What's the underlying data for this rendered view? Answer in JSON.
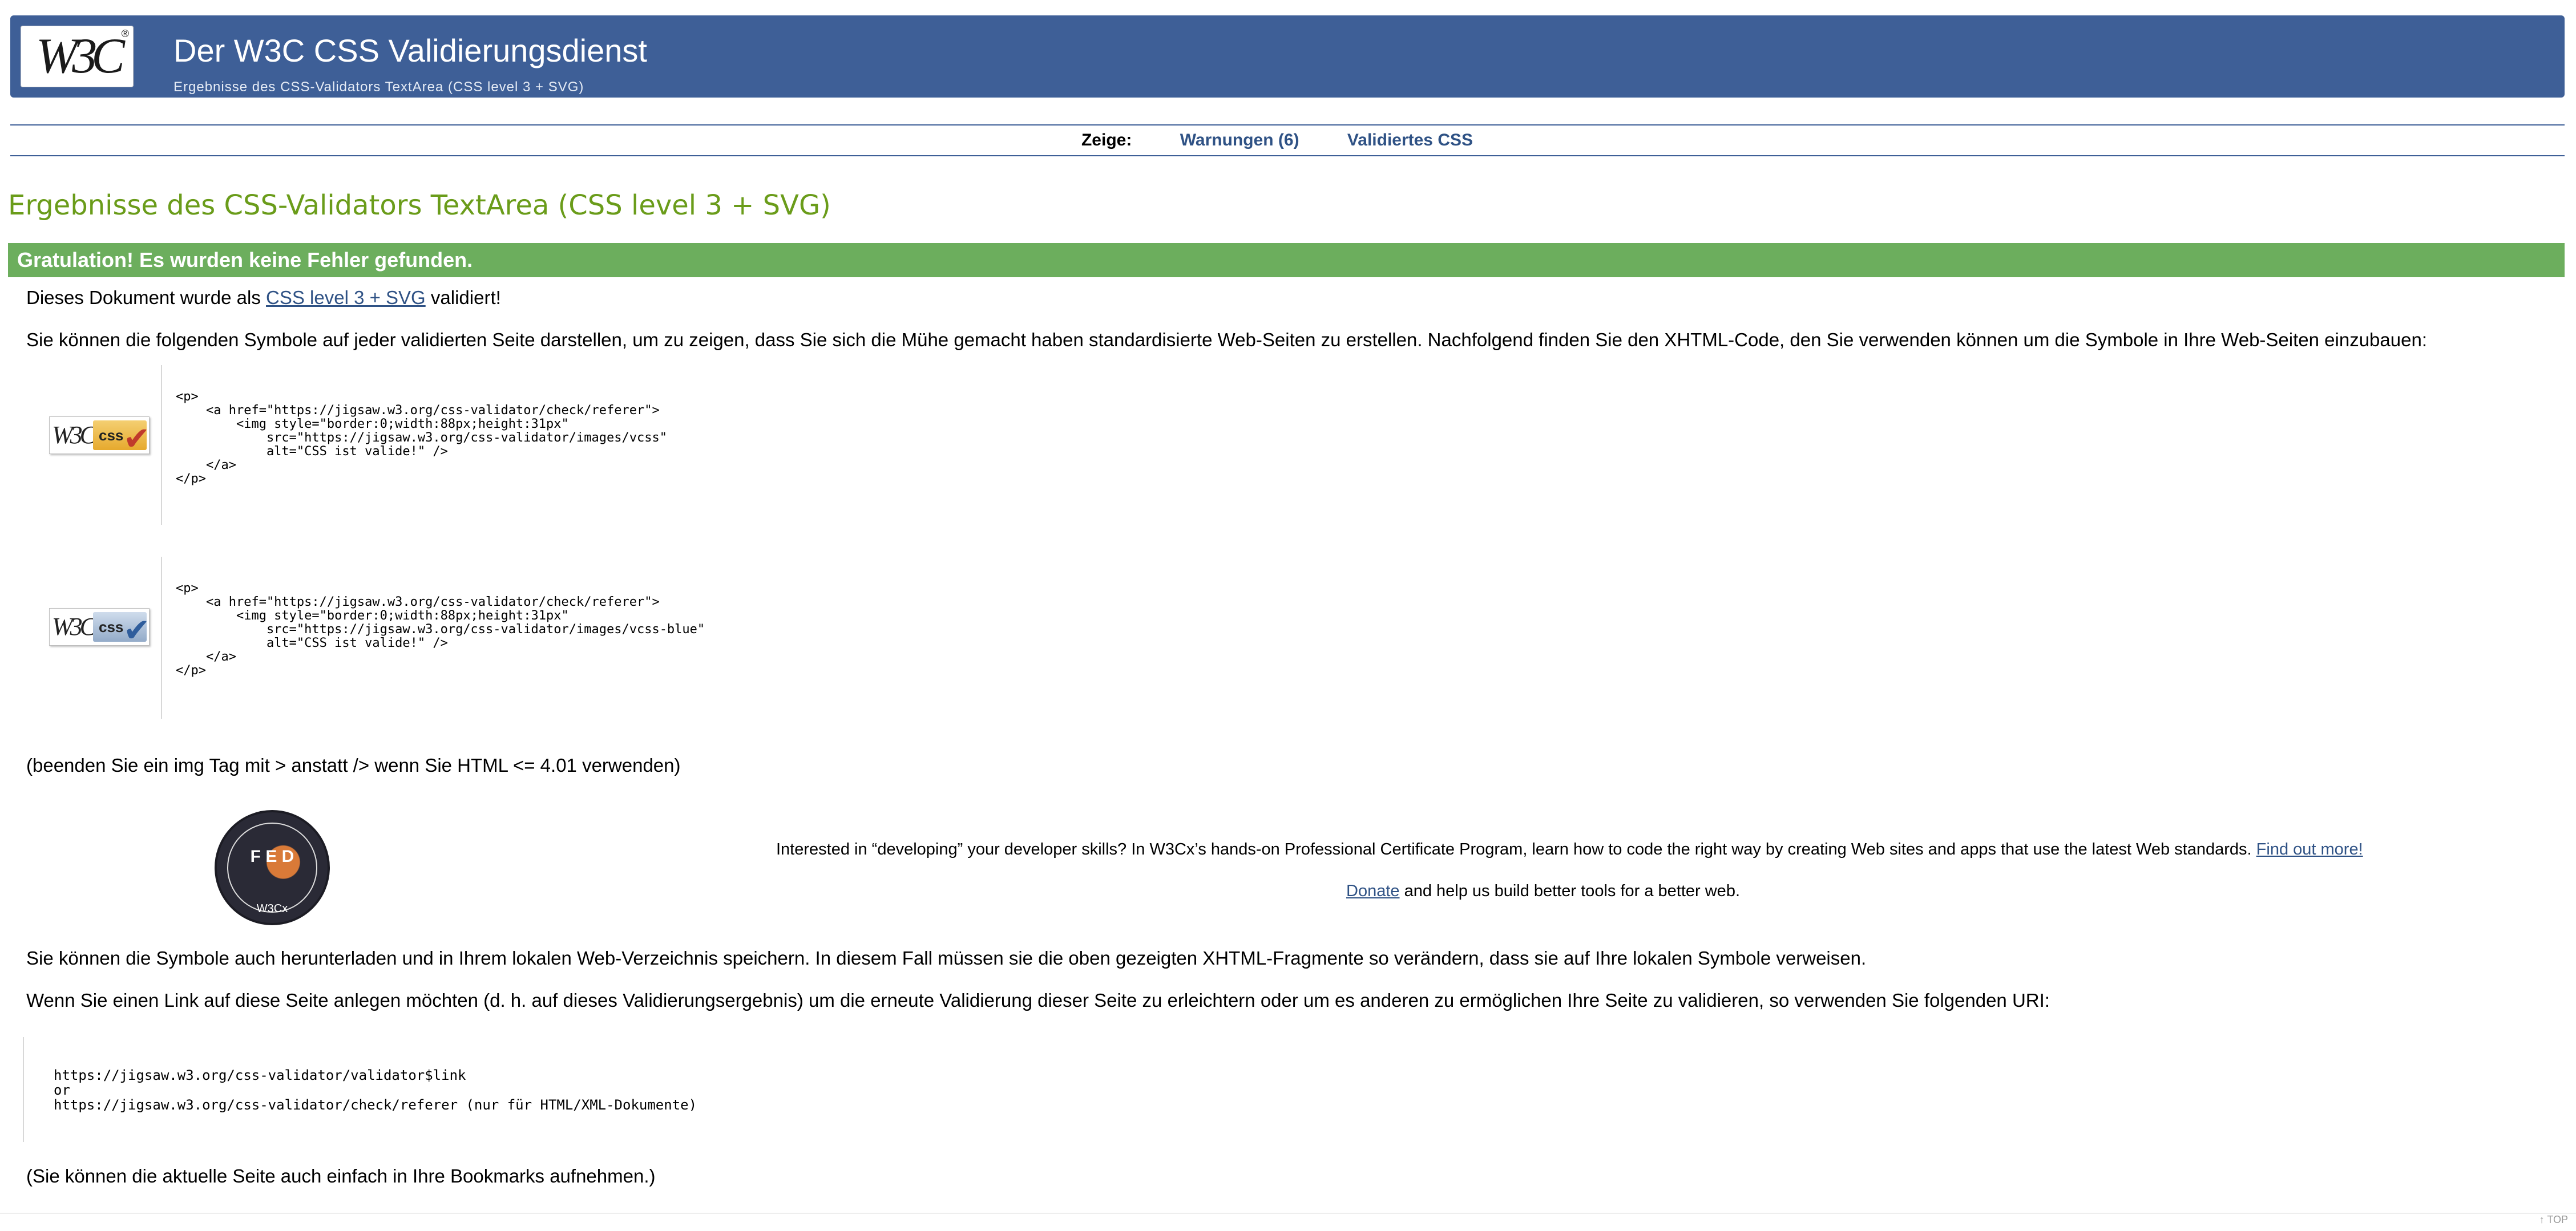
{
  "header": {
    "logo_text": "W3C",
    "logo_reg": "®",
    "title": "Der W3C CSS Validierungsdienst",
    "subtitle": "Ergebnisse des CSS-Validators TextArea (CSS level 3 + SVG)",
    "colors": {
      "banner": "#3e5f97"
    }
  },
  "nav": {
    "label": "Zeige:",
    "items": [
      {
        "label": "Warnungen (6)"
      },
      {
        "label": "Validiertes CSS"
      }
    ]
  },
  "results": {
    "heading": "Ergebnisse des CSS-Validators TextArea (CSS level 3 + SVG)",
    "congrats": "Gratulation! Es wurden keine Fehler gefunden.",
    "validated_prefix": "Dieses Dokument wurde als",
    "validated_link": "CSS level 3 + SVG",
    "validated_suffix": "validiert!",
    "symbols_intro": "Sie können die folgenden Symbole auf jeder validierten Seite darstellen, um zu zeigen, dass Sie sich die Mühe gemacht haben standardisierte Web-Seiten zu erstellen. Nachfolgend finden Sie den XHTML-Code, den Sie verwenden können um die Symbole in Ihre Web-Seiten einzubauen:",
    "badges": [
      {
        "icon": "w3c-css-gold-badge-icon",
        "w3c": "W3C",
        "css": "css",
        "code": "<p>\n    <a href=\"https://jigsaw.w3.org/css-validator/check/referer\">\n        <img style=\"border:0;width:88px;height:31px\"\n            src=\"https://jigsaw.w3.org/css-validator/images/vcss\"\n            alt=\"CSS ist valide!\" />\n    </a>\n</p>"
      },
      {
        "icon": "w3c-css-blue-badge-icon",
        "w3c": "W3C",
        "css": "css",
        "code": "<p>\n    <a href=\"https://jigsaw.w3.org/css-validator/check/referer\">\n        <img style=\"border:0;width:88px;height:31px\"\n            src=\"https://jigsaw.w3.org/css-validator/images/vcss-blue\"\n            alt=\"CSS ist valide!\" />\n    </a>\n</p>"
      }
    ],
    "html_note": "(beenden Sie ein img Tag mit > anstatt /> wenn Sie HTML <= 4.01 verwenden)",
    "promo": {
      "badge_icon": "w3cx-front-end-developer-badge-icon",
      "badge_mid": "F E D",
      "badge_bottom": "W3Cx",
      "text": "Interested in “developing” your developer skills? In W3Cx’s hands-on Professional Certificate Program, learn how to code the right way by creating Web sites and apps that use the latest Web standards.",
      "link": "Find out more!",
      "donate_link": "Donate",
      "donate_text": " and help us build better tools for a better web."
    },
    "download_note": "Sie können die Symbole auch herunterladen und in Ihrem lokalen Web-Verzeichnis speichern. In diesem Fall müssen sie die oben gezeigten XHTML-Fragmente so verändern, dass sie auf Ihre lokalen Symbole verweisen.",
    "link_note": "Wenn Sie einen Link auf diese Seite anlegen möchten (d. h. auf dieses Validierungsergebnis) um die erneute Validierung dieser Seite zu erleichtern oder um es anderen zu ermöglichen Ihre Seite zu validieren, so verwenden Sie folgenden URI:",
    "uri_code": "https://jigsaw.w3.org/css-validator/validator$link\nor\nhttps://jigsaw.w3.org/css-validator/check/referer (nur für HTML/XML-Dokumente)",
    "bookmark_note": "(Sie können die aktuelle Seite auch einfach in Ihre Bookmarks aufnehmen.)"
  },
  "footer": {
    "top_link": "↑ TOP"
  }
}
